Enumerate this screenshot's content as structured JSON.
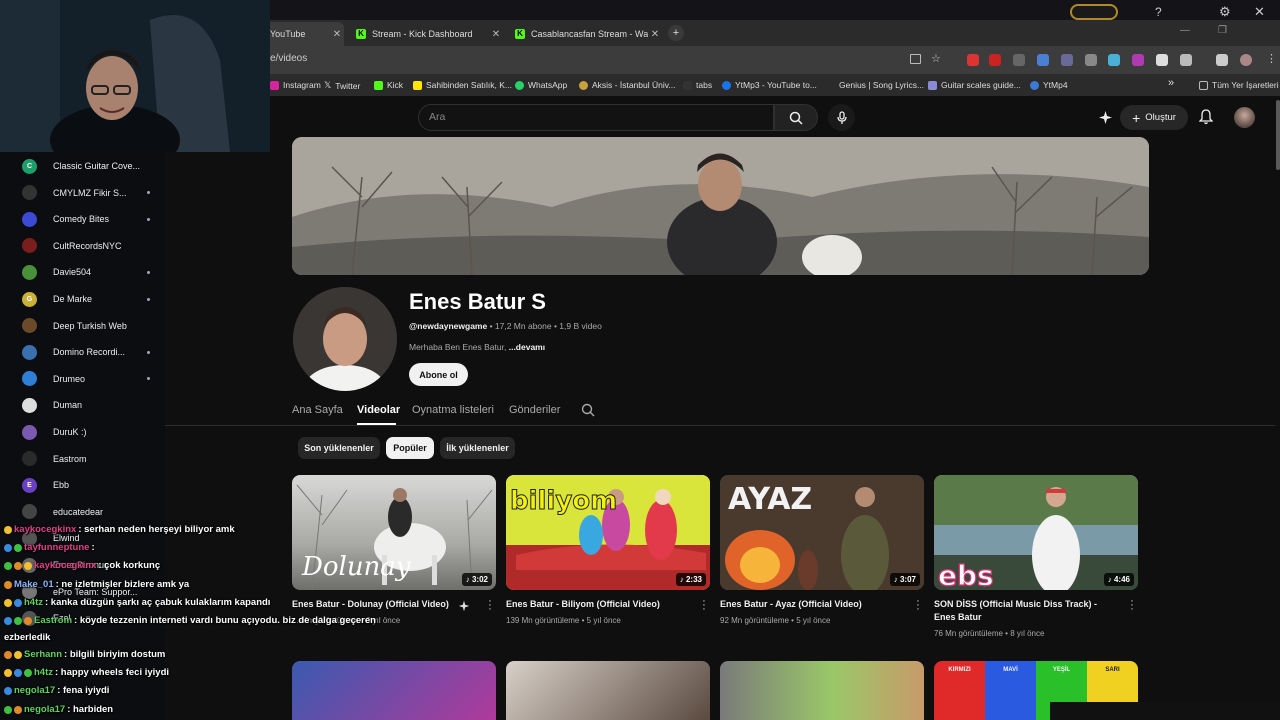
{
  "browser": {
    "tabs": [
      {
        "label": "YouTube",
        "active": true
      },
      {
        "label": "Stream - Kick Dashboard",
        "active": false
      },
      {
        "label": "Casablancasfan Stream - Watch",
        "active": false
      }
    ],
    "new_tab": "+",
    "url": "e/videos",
    "bookmarks": [
      "Instagram",
      "Twitter",
      "Kick",
      "Sahibinden Satılık, K...",
      "WhatsApp",
      "Aksis - İstanbul Üniv...",
      "tabs",
      "YtMp3 - YouTube to...",
      "Genius | Song Lyrics...",
      "Guitar scales guide...",
      "YtMp4"
    ],
    "all_bookmarks": "Tüm Yer İşaretleri",
    "more_bookmarks": "»"
  },
  "youtube": {
    "search_placeholder": "Ara",
    "create_label": "Oluştur",
    "channel": {
      "name": "Enes Batur S",
      "handle": "@newdaynewgame",
      "meta_rest": " • 17,2 Mn abone • 1,9 B video",
      "description": "Merhaba Ben Enes Batur,",
      "more": "...devamı",
      "subscribe": "Abone ol"
    },
    "nav_tabs": [
      "Ana Sayfa",
      "Videolar",
      "Oynatma listeleri",
      "Gönderiler"
    ],
    "chips": [
      "Son yüklenenler",
      "Popüler",
      "İlk yüklenenler"
    ],
    "videos": [
      {
        "title": "Enes Batur - Dolunay (Official Video)",
        "views": "... Mn görüntüleme",
        "age": "6 yıl önce",
        "duration": "3:02",
        "thumb_text": "Dolunay"
      },
      {
        "title": "Enes Batur - Biliyom (Official Video)",
        "views": "139 Mn görüntüleme",
        "age": "5 yıl önce",
        "duration": "2:33",
        "thumb_text": "biliyom"
      },
      {
        "title": "Enes Batur - Ayaz (Official Video)",
        "views": "92 Mn görüntüleme",
        "age": "5 yıl önce",
        "duration": "3:07",
        "thumb_text": "AYAZ"
      },
      {
        "title": "SON DİSS (Official Music Diss Track) - Enes Batur",
        "views": "76 Mn görüntüleme",
        "age": "8 yıl önce",
        "duration": "4:46",
        "thumb_text": "ebs"
      }
    ],
    "row2_labels": [
      "KIRMIZI",
      "MAVİ",
      "YEŞİL",
      "SARI"
    ]
  },
  "sidebar": {
    "items": [
      {
        "name": "Classic Guitar Cove...",
        "color": "#1e9e6a",
        "letter": "C",
        "live": false
      },
      {
        "name": "CMYLMZ Fikir S...",
        "color": "#333333",
        "letter": "",
        "live": true
      },
      {
        "name": "Comedy Bites",
        "color": "#3b4bd6",
        "letter": "",
        "live": true
      },
      {
        "name": "CultRecordsNYC",
        "color": "#7a1d1d",
        "letter": "",
        "live": false
      },
      {
        "name": "Davie504",
        "color": "#4a8f3a",
        "letter": "",
        "live": true
      },
      {
        "name": "De Marke",
        "color": "#c9b13a",
        "letter": "G",
        "live": true
      },
      {
        "name": "Deep Turkish Web",
        "color": "#6b4a2a",
        "letter": "",
        "live": false
      },
      {
        "name": "Domino Recordi...",
        "color": "#3a6fb0",
        "letter": "",
        "live": true
      },
      {
        "name": "Drumeo",
        "color": "#2f7fd6",
        "letter": "",
        "live": true
      },
      {
        "name": "Duman",
        "color": "#dddddd",
        "letter": "",
        "live": false
      },
      {
        "name": "DuruK :)",
        "color": "#7a5ab0",
        "letter": "",
        "live": false
      },
      {
        "name": "Eastrom",
        "color": "#2a2a2a",
        "letter": "",
        "live": false
      },
      {
        "name": "Ebb",
        "color": "#6b3fc4",
        "letter": "E",
        "live": false
      },
      {
        "name": "educatedear",
        "color": "#444444",
        "letter": "",
        "live": false
      },
      {
        "name": "Elwind",
        "color": "#555555",
        "letter": "",
        "live": false
      },
      {
        "name": "Emre Durmuş",
        "color": "#666666",
        "letter": "",
        "live": false
      },
      {
        "name": "ePro Team: Suppor...",
        "color": "#777777",
        "letter": "",
        "live": false
      },
      {
        "name": "Ezel",
        "color": "#555555",
        "letter": "",
        "live": false
      }
    ]
  },
  "chat": [
    {
      "user": "kaykocegkinx",
      "msg": ": serhan neden herşeyi biliyor amk",
      "color": "#e0408a"
    },
    {
      "user": "tayfunneptune",
      "msg": ":",
      "color": "#e0408a"
    },
    {
      "user": "kaykocegkinx",
      "msg": ": çok korkunç",
      "color": "#e0408a"
    },
    {
      "user": "Make_01",
      "msg": ": ne izletmişler bizlere amk ya",
      "color": "#8ab4f8"
    },
    {
      "user": "h4tz",
      "msg": ": kanka düzgün şarkı aç çabuk kulaklarım kapandı",
      "color": "#5fd35f"
    },
    {
      "user": "Eastrom",
      "msg": ": köyde tezzenin interneti vardı bunu açıyodu. biz de dalga geçeren",
      "color": "#5fd35f"
    },
    {
      "user": "ezberledik",
      "msg": "",
      "color": "#ffffff"
    },
    {
      "user": "Serhann",
      "msg": ": bilgili biriyim dostum",
      "color": "#5fd35f"
    },
    {
      "user": "h4tz",
      "msg": ": happy wheels feci iyiydi",
      "color": "#5fd35f"
    },
    {
      "user": "negola17",
      "msg": ": fena iyiydi",
      "color": "#5fd35f"
    },
    {
      "user": "negola17",
      "msg": ": harbiden",
      "color": "#5fd35f"
    }
  ]
}
